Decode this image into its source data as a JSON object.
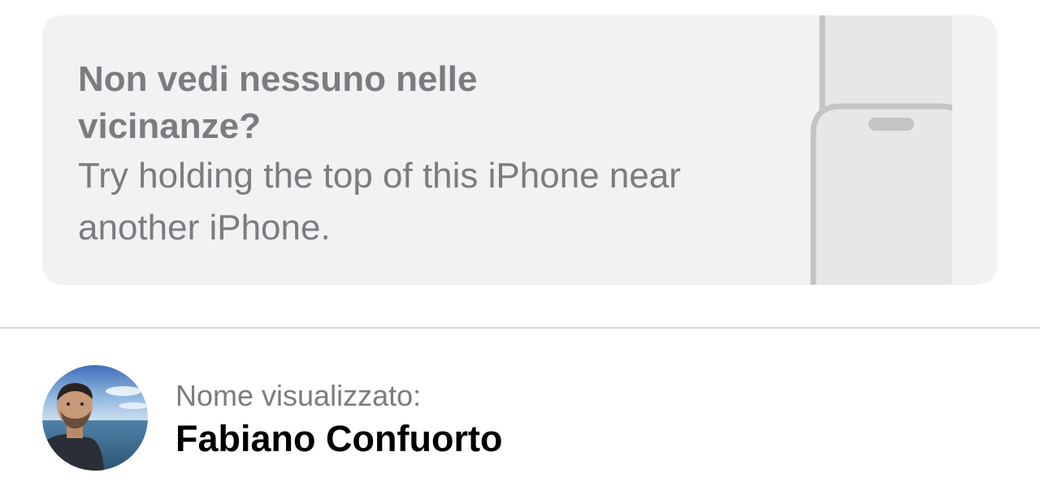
{
  "nearby_card": {
    "title": "Non vedi nessuno nelle vicinanze?",
    "description": "Try holding the top of this iPhone near another iPhone.",
    "illustration_icon": "phones-touching-top-icon"
  },
  "profile": {
    "caption": "Nome visualizzato:",
    "display_name": "Fabiano Confuorto",
    "avatar_icon": "profile-photo"
  },
  "colors": {
    "card_background": "#f2f2f4",
    "secondary_text": "#7c7c80",
    "primary_text": "#000000",
    "divider": "#d8d8dc"
  }
}
